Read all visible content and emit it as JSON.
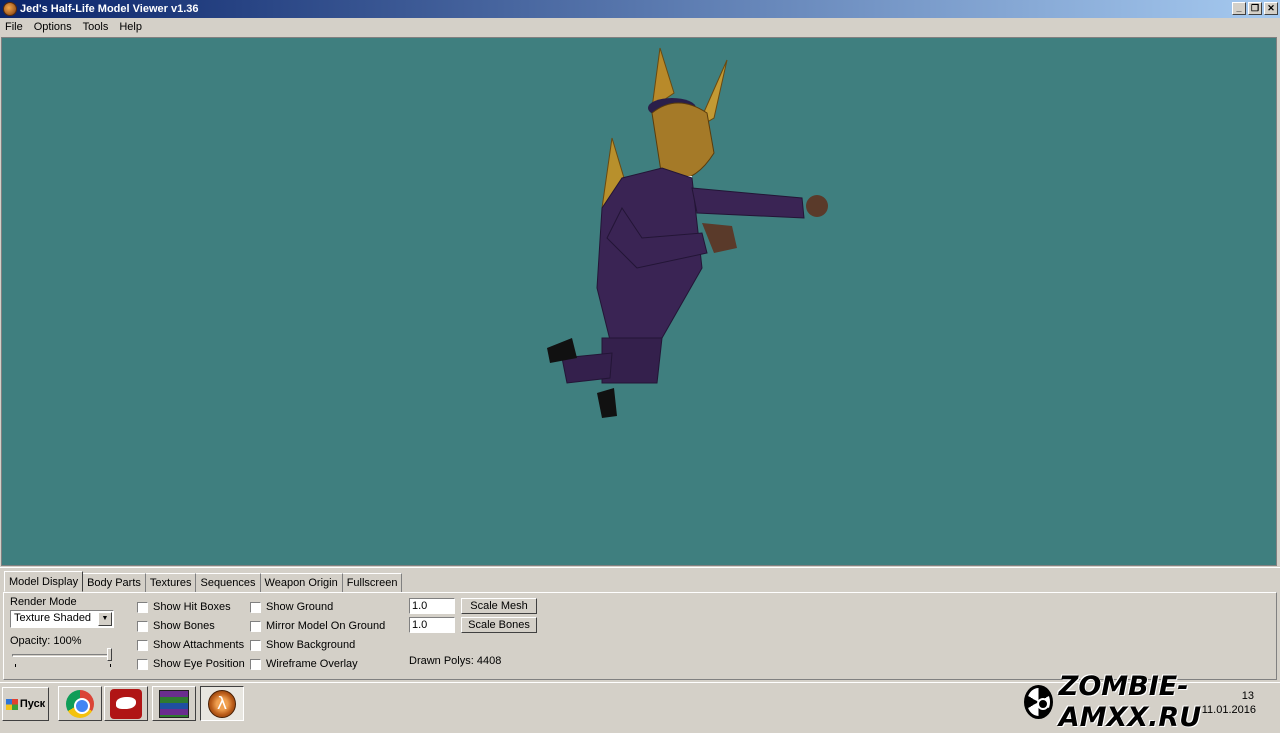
{
  "window": {
    "title": "Jed's Half-Life Model Viewer v1.36",
    "buttons": [
      "_",
      "❐",
      "✕"
    ]
  },
  "menu": [
    "File",
    "Options",
    "Tools",
    "Help"
  ],
  "colors": {
    "viewport_bg": "#3f7f7f",
    "titlebar_start": "#0a246a",
    "titlebar_end": "#a6caf0"
  },
  "tabs": [
    {
      "label": "Model Display",
      "active": true
    },
    {
      "label": "Body Parts"
    },
    {
      "label": "Textures"
    },
    {
      "label": "Sequences"
    },
    {
      "label": "Weapon Origin"
    },
    {
      "label": "Fullscreen"
    }
  ],
  "model_display": {
    "render_mode_label": "Render Mode",
    "render_mode_value": "Texture Shaded",
    "opacity_label": "Opacity: 100%",
    "opacity_value": 1.0,
    "checkboxes_col1": [
      "Show Hit Boxes",
      "Show Bones",
      "Show Attachments",
      "Show Eye Position"
    ],
    "checkboxes_col2": [
      "Show Ground",
      "Mirror Model On Ground",
      "Show Background",
      "Wireframe Overlay"
    ],
    "scale_mesh_value": "1.0",
    "scale_mesh_button": "Scale Mesh",
    "scale_bones_value": "1.0",
    "scale_bones_button": "Scale Bones",
    "drawn_polys": "Drawn Polys: 4408"
  },
  "taskbar": {
    "start_label": "Пуск",
    "apps": [
      "chrome-icon",
      "panther-icon",
      "winrar-icon",
      "half-life-icon"
    ],
    "clock_time": "13",
    "clock_date": "11.01.2016"
  },
  "watermark": "ZOMBIE-AMXX.RU"
}
